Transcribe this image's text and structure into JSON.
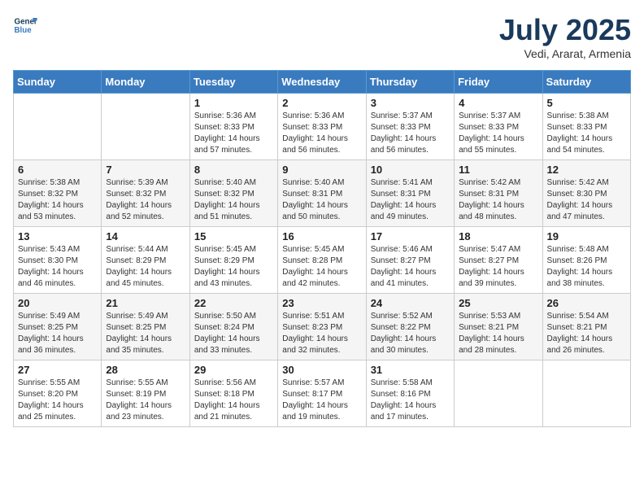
{
  "header": {
    "logo_line1": "General",
    "logo_line2": "Blue",
    "month_title": "July 2025",
    "location": "Vedi, Ararat, Armenia"
  },
  "weekdays": [
    "Sunday",
    "Monday",
    "Tuesday",
    "Wednesday",
    "Thursday",
    "Friday",
    "Saturday"
  ],
  "weeks": [
    [
      {
        "day": "",
        "sunrise": "",
        "sunset": "",
        "daylight": ""
      },
      {
        "day": "",
        "sunrise": "",
        "sunset": "",
        "daylight": ""
      },
      {
        "day": "1",
        "sunrise": "Sunrise: 5:36 AM",
        "sunset": "Sunset: 8:33 PM",
        "daylight": "Daylight: 14 hours and 57 minutes."
      },
      {
        "day": "2",
        "sunrise": "Sunrise: 5:36 AM",
        "sunset": "Sunset: 8:33 PM",
        "daylight": "Daylight: 14 hours and 56 minutes."
      },
      {
        "day": "3",
        "sunrise": "Sunrise: 5:37 AM",
        "sunset": "Sunset: 8:33 PM",
        "daylight": "Daylight: 14 hours and 56 minutes."
      },
      {
        "day": "4",
        "sunrise": "Sunrise: 5:37 AM",
        "sunset": "Sunset: 8:33 PM",
        "daylight": "Daylight: 14 hours and 55 minutes."
      },
      {
        "day": "5",
        "sunrise": "Sunrise: 5:38 AM",
        "sunset": "Sunset: 8:33 PM",
        "daylight": "Daylight: 14 hours and 54 minutes."
      }
    ],
    [
      {
        "day": "6",
        "sunrise": "Sunrise: 5:38 AM",
        "sunset": "Sunset: 8:32 PM",
        "daylight": "Daylight: 14 hours and 53 minutes."
      },
      {
        "day": "7",
        "sunrise": "Sunrise: 5:39 AM",
        "sunset": "Sunset: 8:32 PM",
        "daylight": "Daylight: 14 hours and 52 minutes."
      },
      {
        "day": "8",
        "sunrise": "Sunrise: 5:40 AM",
        "sunset": "Sunset: 8:32 PM",
        "daylight": "Daylight: 14 hours and 51 minutes."
      },
      {
        "day": "9",
        "sunrise": "Sunrise: 5:40 AM",
        "sunset": "Sunset: 8:31 PM",
        "daylight": "Daylight: 14 hours and 50 minutes."
      },
      {
        "day": "10",
        "sunrise": "Sunrise: 5:41 AM",
        "sunset": "Sunset: 8:31 PM",
        "daylight": "Daylight: 14 hours and 49 minutes."
      },
      {
        "day": "11",
        "sunrise": "Sunrise: 5:42 AM",
        "sunset": "Sunset: 8:31 PM",
        "daylight": "Daylight: 14 hours and 48 minutes."
      },
      {
        "day": "12",
        "sunrise": "Sunrise: 5:42 AM",
        "sunset": "Sunset: 8:30 PM",
        "daylight": "Daylight: 14 hours and 47 minutes."
      }
    ],
    [
      {
        "day": "13",
        "sunrise": "Sunrise: 5:43 AM",
        "sunset": "Sunset: 8:30 PM",
        "daylight": "Daylight: 14 hours and 46 minutes."
      },
      {
        "day": "14",
        "sunrise": "Sunrise: 5:44 AM",
        "sunset": "Sunset: 8:29 PM",
        "daylight": "Daylight: 14 hours and 45 minutes."
      },
      {
        "day": "15",
        "sunrise": "Sunrise: 5:45 AM",
        "sunset": "Sunset: 8:29 PM",
        "daylight": "Daylight: 14 hours and 43 minutes."
      },
      {
        "day": "16",
        "sunrise": "Sunrise: 5:45 AM",
        "sunset": "Sunset: 8:28 PM",
        "daylight": "Daylight: 14 hours and 42 minutes."
      },
      {
        "day": "17",
        "sunrise": "Sunrise: 5:46 AM",
        "sunset": "Sunset: 8:27 PM",
        "daylight": "Daylight: 14 hours and 41 minutes."
      },
      {
        "day": "18",
        "sunrise": "Sunrise: 5:47 AM",
        "sunset": "Sunset: 8:27 PM",
        "daylight": "Daylight: 14 hours and 39 minutes."
      },
      {
        "day": "19",
        "sunrise": "Sunrise: 5:48 AM",
        "sunset": "Sunset: 8:26 PM",
        "daylight": "Daylight: 14 hours and 38 minutes."
      }
    ],
    [
      {
        "day": "20",
        "sunrise": "Sunrise: 5:49 AM",
        "sunset": "Sunset: 8:25 PM",
        "daylight": "Daylight: 14 hours and 36 minutes."
      },
      {
        "day": "21",
        "sunrise": "Sunrise: 5:49 AM",
        "sunset": "Sunset: 8:25 PM",
        "daylight": "Daylight: 14 hours and 35 minutes."
      },
      {
        "day": "22",
        "sunrise": "Sunrise: 5:50 AM",
        "sunset": "Sunset: 8:24 PM",
        "daylight": "Daylight: 14 hours and 33 minutes."
      },
      {
        "day": "23",
        "sunrise": "Sunrise: 5:51 AM",
        "sunset": "Sunset: 8:23 PM",
        "daylight": "Daylight: 14 hours and 32 minutes."
      },
      {
        "day": "24",
        "sunrise": "Sunrise: 5:52 AM",
        "sunset": "Sunset: 8:22 PM",
        "daylight": "Daylight: 14 hours and 30 minutes."
      },
      {
        "day": "25",
        "sunrise": "Sunrise: 5:53 AM",
        "sunset": "Sunset: 8:21 PM",
        "daylight": "Daylight: 14 hours and 28 minutes."
      },
      {
        "day": "26",
        "sunrise": "Sunrise: 5:54 AM",
        "sunset": "Sunset: 8:21 PM",
        "daylight": "Daylight: 14 hours and 26 minutes."
      }
    ],
    [
      {
        "day": "27",
        "sunrise": "Sunrise: 5:55 AM",
        "sunset": "Sunset: 8:20 PM",
        "daylight": "Daylight: 14 hours and 25 minutes."
      },
      {
        "day": "28",
        "sunrise": "Sunrise: 5:55 AM",
        "sunset": "Sunset: 8:19 PM",
        "daylight": "Daylight: 14 hours and 23 minutes."
      },
      {
        "day": "29",
        "sunrise": "Sunrise: 5:56 AM",
        "sunset": "Sunset: 8:18 PM",
        "daylight": "Daylight: 14 hours and 21 minutes."
      },
      {
        "day": "30",
        "sunrise": "Sunrise: 5:57 AM",
        "sunset": "Sunset: 8:17 PM",
        "daylight": "Daylight: 14 hours and 19 minutes."
      },
      {
        "day": "31",
        "sunrise": "Sunrise: 5:58 AM",
        "sunset": "Sunset: 8:16 PM",
        "daylight": "Daylight: 14 hours and 17 minutes."
      },
      {
        "day": "",
        "sunrise": "",
        "sunset": "",
        "daylight": ""
      },
      {
        "day": "",
        "sunrise": "",
        "sunset": "",
        "daylight": ""
      }
    ]
  ]
}
